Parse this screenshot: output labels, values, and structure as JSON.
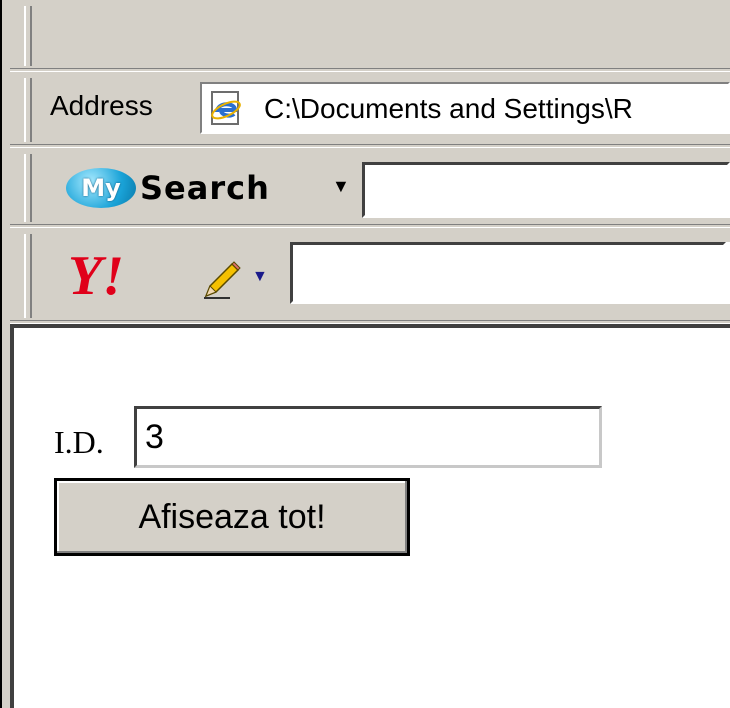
{
  "address_bar": {
    "label": "Address",
    "value": "C:\\Documents and Settings\\R",
    "icon": "ie-page-icon"
  },
  "mysearch_toolbar": {
    "logo_my": "My",
    "logo_search": "Search",
    "dropdown_icon": "chevron-down-icon",
    "input_value": ""
  },
  "yahoo_toolbar": {
    "logo_text": "Y!",
    "pencil_icon": "pencil-icon",
    "input_value": ""
  },
  "form": {
    "id_label": "I.D.",
    "id_value": "3",
    "submit_label": "Afiseaza tot!"
  },
  "colors": {
    "chrome": "#d4d0c8",
    "yahoo_red": "#e0001a",
    "mysearch_blue": "#1aa3d8"
  }
}
